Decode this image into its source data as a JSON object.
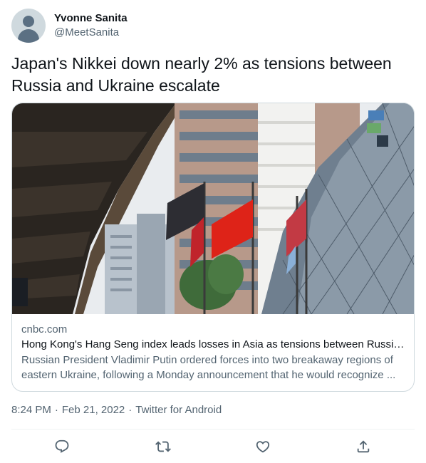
{
  "author": {
    "display_name": "Yvonne Sanita",
    "handle": "@MeetSanita",
    "avatar_icon": "default-avatar-icon"
  },
  "tweet": {
    "text": "Japan's Nikkei down nearly 2% as tensions between Russia and Ukraine escalate"
  },
  "card": {
    "image_icon": "news-photo-flags-buildings",
    "domain": "cnbc.com",
    "title": "Hong Kong's Hang Seng index leads losses in Asia as tensions between Russia ...",
    "description": "Russian President Vladimir Putin ordered forces into two breakaway regions of eastern Ukraine, following a Monday announcement that he would recognize ..."
  },
  "meta": {
    "time": "8:24 PM",
    "separator": "·",
    "date": "Feb 21, 2022",
    "source": "Twitter for Android"
  },
  "actions": [
    {
      "name": "reply",
      "icon": "reply-icon"
    },
    {
      "name": "retweet",
      "icon": "retweet-icon"
    },
    {
      "name": "like",
      "icon": "heart-icon"
    },
    {
      "name": "share",
      "icon": "share-icon"
    }
  ],
  "colors": {
    "text_primary": "#0f1419",
    "text_secondary": "#536471",
    "border": "#cfd9de",
    "icon": "#536471"
  }
}
